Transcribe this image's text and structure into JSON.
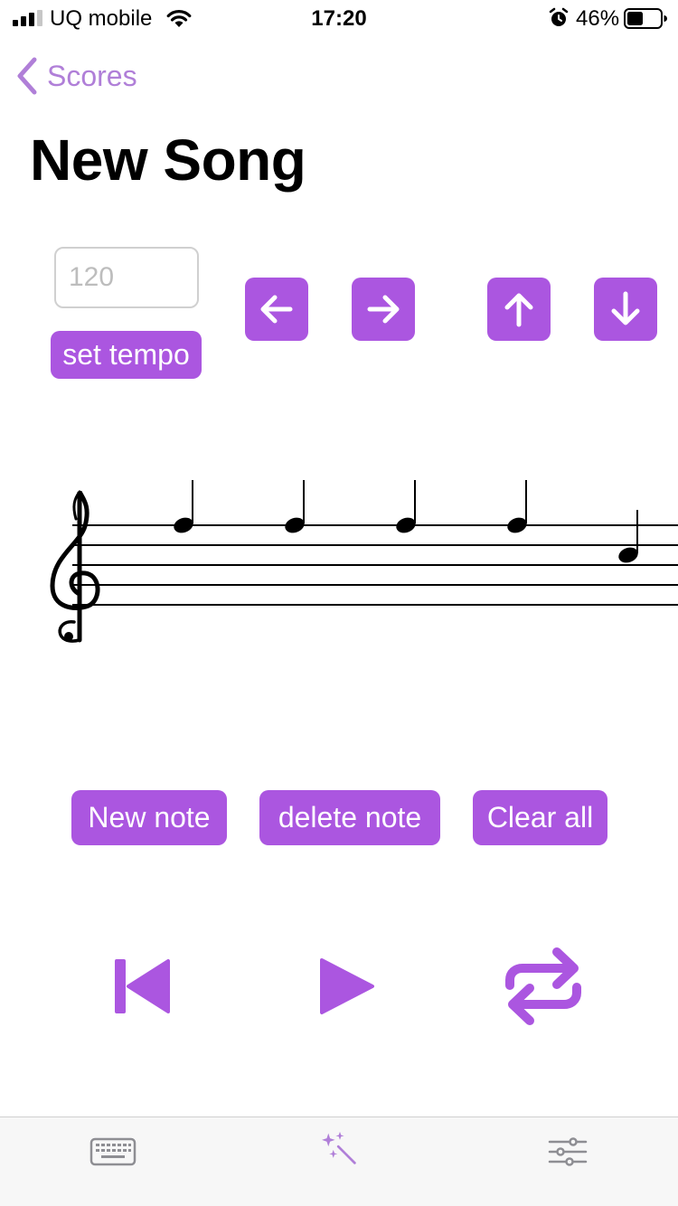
{
  "status_bar": {
    "carrier": "UQ mobile",
    "time": "17:20",
    "battery_percent": "46%",
    "signal_bars": 3,
    "battery_level": 0.46,
    "icons": [
      "signal-icon",
      "wifi-icon",
      "alarm-icon",
      "battery-icon"
    ]
  },
  "nav": {
    "back_label": "Scores",
    "back_icon": "chevron-left-icon"
  },
  "page": {
    "title": "New Song"
  },
  "tempo": {
    "placeholder": "120",
    "set_label": "set tempo"
  },
  "arrow_buttons": [
    {
      "icon": "arrow-left-icon"
    },
    {
      "icon": "arrow-right-icon"
    },
    {
      "icon": "arrow-up-icon"
    },
    {
      "icon": "arrow-down-icon"
    }
  ],
  "score": {
    "clef": "treble",
    "notes": [
      {
        "duration": "quarter",
        "pitch": "F5"
      },
      {
        "duration": "quarter",
        "pitch": "F5"
      },
      {
        "duration": "quarter",
        "pitch": "F5"
      },
      {
        "duration": "quarter",
        "pitch": "F5"
      },
      {
        "duration": "quarter",
        "pitch": "C5"
      }
    ]
  },
  "edit_buttons": {
    "new_note": "New note",
    "delete_note": "delete note",
    "clear_all": "Clear all"
  },
  "transport": {
    "icons": [
      "skip-back-icon",
      "play-icon",
      "repeat-icon"
    ]
  },
  "tab_bar": {
    "tabs": [
      {
        "icon": "keyboard-icon",
        "selected": false
      },
      {
        "icon": "magic-wand-icon",
        "selected": true
      },
      {
        "icon": "sliders-icon",
        "selected": false
      }
    ]
  },
  "colors": {
    "accent": "#ab56e0",
    "accent_light": "#b07fd8",
    "tab_inactive": "#8e8e93"
  }
}
